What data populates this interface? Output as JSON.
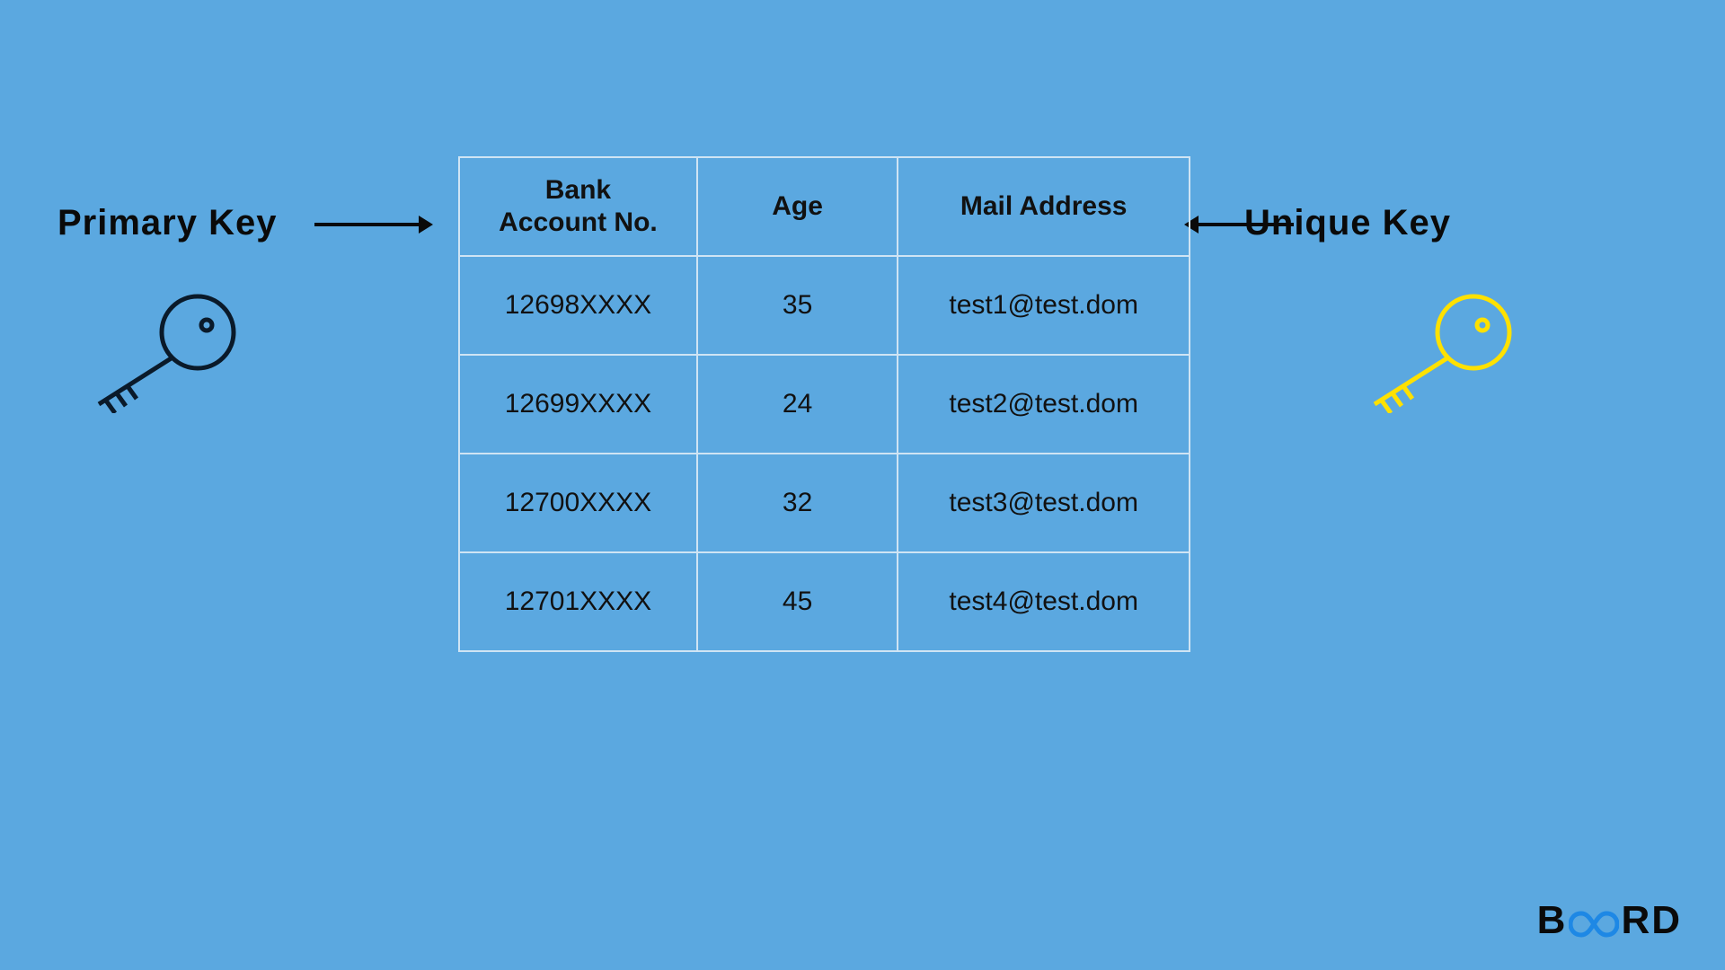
{
  "labels": {
    "primary": "Primary Key",
    "unique": "Unique Key"
  },
  "table": {
    "headers": {
      "col1_line1": "Bank",
      "col1_line2": "Account No.",
      "col2": "Age",
      "col3": "Mail Address"
    },
    "rows": [
      {
        "acct": "12698XXXX",
        "age": "35",
        "mail": "test1@test.dom"
      },
      {
        "acct": "12699XXXX",
        "age": "24",
        "mail": "test2@test.dom"
      },
      {
        "acct": "12700XXXX",
        "age": "32",
        "mail": "test3@test.dom"
      },
      {
        "acct": "12701XXXX",
        "age": "45",
        "mail": "test4@test.dom"
      }
    ]
  },
  "icons": {
    "primary_key_color": "#0a1a2a",
    "unique_key_color": "#ffe100"
  },
  "brand": {
    "b": "B",
    "rd": "RD"
  },
  "chart_data": {
    "type": "table",
    "title": "",
    "columns": [
      "Bank Account No.",
      "Age",
      "Mail Address"
    ],
    "rows": [
      [
        "12698XXXX",
        35,
        "test1@test.dom"
      ],
      [
        "12699XXXX",
        24,
        "test2@test.dom"
      ],
      [
        "12700XXXX",
        32,
        "test3@test.dom"
      ],
      [
        "12701XXXX",
        45,
        "test4@test.dom"
      ]
    ],
    "annotations": {
      "primary_key_column": "Bank Account No.",
      "unique_key_column": "Mail Address"
    }
  }
}
